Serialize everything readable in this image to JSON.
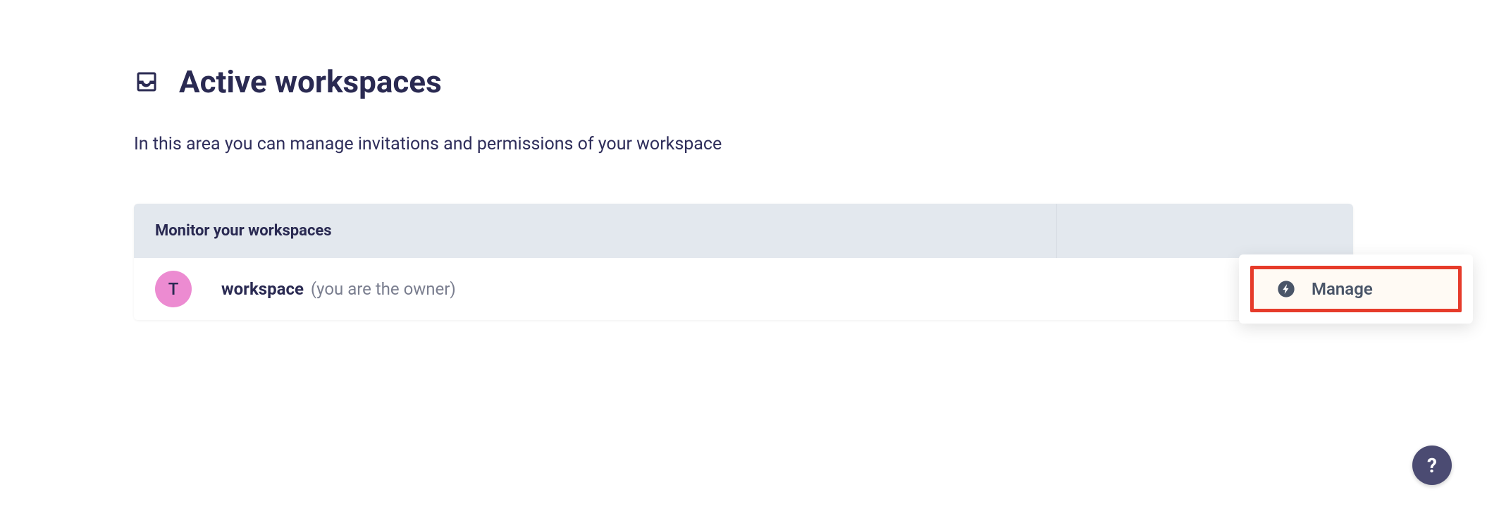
{
  "page": {
    "title": "Active workspaces",
    "subtitle": "In this area you can manage invitations and permissions of your workspace"
  },
  "table": {
    "header_left": "Monitor your workspaces",
    "rows": [
      {
        "avatar_letter": "T",
        "name": "workspace",
        "role": "(you are the owner)"
      }
    ]
  },
  "actions": {
    "manage_label": "Manage"
  },
  "help": {
    "label": "?"
  }
}
